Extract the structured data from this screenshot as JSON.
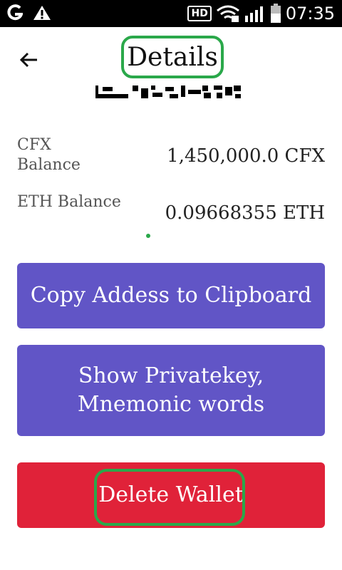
{
  "status_bar": {
    "time": "07:35",
    "hd_label": "HD",
    "icons": [
      "g-icon",
      "warning-icon",
      "wifi-icon",
      "signal-icon",
      "battery-icon"
    ]
  },
  "header": {
    "title": "Details",
    "back_icon": "arrow-left-icon"
  },
  "balances": [
    {
      "label": "CFX Balance",
      "value": "1,450,000.0 CFX"
    },
    {
      "label": "ETH Balance",
      "value": "0.09668355 ETH"
    }
  ],
  "buttons": {
    "copy": "Copy Addess to Clipboard",
    "show_keys": "Show Privatekey, Mnemonic words",
    "delete": "Delete Wallet"
  },
  "colors": {
    "primary_button": "#6155c6",
    "danger_button": "#e02239",
    "highlight": "#2aa84a"
  }
}
